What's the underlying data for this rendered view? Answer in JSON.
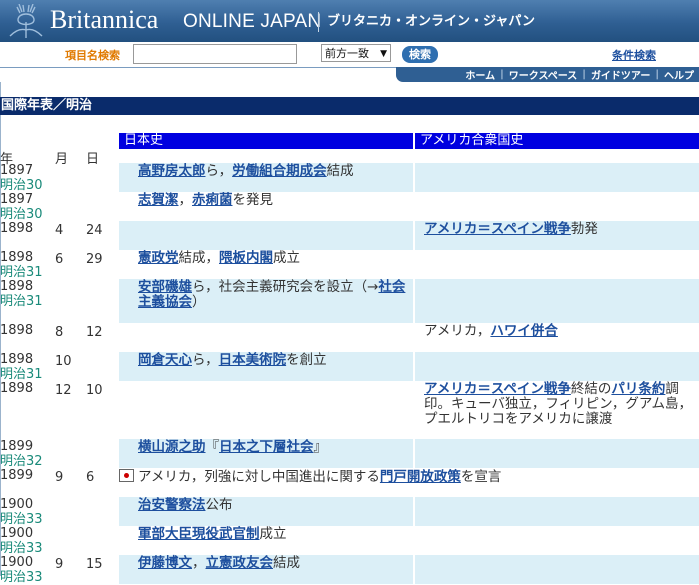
{
  "header": {
    "brand": "Britannica",
    "brand_sub": "ONLINE JAPAN",
    "brand_jp": "ブリタニカ・オンライン・ジャパン"
  },
  "search": {
    "label": "項目名検索",
    "value": "",
    "mode": "前方一致",
    "button": "検索",
    "advanced": "条件検索"
  },
  "nav": {
    "items": [
      "ホーム",
      "ワークスペース",
      "ガイドツアー",
      "ヘルプ"
    ]
  },
  "page": {
    "title": "国際年表／明治",
    "col_japan": "日本史",
    "col_us": "アメリカ合衆国史",
    "col_year": "年",
    "col_month": "月",
    "col_day": "日"
  },
  "rows": [
    {
      "year": "1897",
      "era": "明治30",
      "month": "",
      "day": "",
      "jp": [
        {
          "t": "高野房太郎",
          "link": true
        },
        {
          "t": "ら，"
        },
        {
          "t": "労働組合期成会",
          "link": true
        },
        {
          "t": "結成"
        }
      ],
      "us": []
    },
    {
      "year": "1897",
      "era": "明治30",
      "month": "",
      "day": "",
      "jp": [
        {
          "t": "志賀潔",
          "link": true
        },
        {
          "t": "，"
        },
        {
          "t": "赤痢菌",
          "link": true
        },
        {
          "t": "を発見"
        }
      ],
      "us": []
    },
    {
      "year": "1898",
      "era": "",
      "month": "4",
      "day": "24",
      "jp": [],
      "us": [
        {
          "t": "アメリカ＝スペイン戦争",
          "link": true
        },
        {
          "t": "勃発"
        }
      ]
    },
    {
      "year": "1898",
      "era": "明治31",
      "month": "6",
      "day": "29",
      "jp": [
        {
          "t": "憲政党",
          "link": true
        },
        {
          "t": "結成，"
        },
        {
          "t": "隈板内閣",
          "link": true
        },
        {
          "t": "成立"
        }
      ],
      "us": []
    },
    {
      "year": "1898",
      "era": "明治31",
      "month": "",
      "day": "",
      "jp": [
        {
          "t": "安部磯雄",
          "link": true
        },
        {
          "t": "ら，社会主義研究会を設立（→"
        },
        {
          "t": "社会主義協会",
          "link": true
        },
        {
          "t": "）"
        }
      ],
      "us": []
    },
    {
      "year": "1898",
      "era": "",
      "month": "8",
      "day": "12",
      "jp": [],
      "us": [
        {
          "t": "アメリカ，"
        },
        {
          "t": "ハワイ併合",
          "link": true
        }
      ]
    },
    {
      "year": "1898",
      "era": "明治31",
      "month": "10",
      "day": "",
      "jp": [
        {
          "t": "岡倉天心",
          "link": true
        },
        {
          "t": "ら，"
        },
        {
          "t": "日本美術院",
          "link": true
        },
        {
          "t": "を創立"
        }
      ],
      "us": []
    },
    {
      "year": "1898",
      "era": "",
      "month": "12",
      "day": "10",
      "jp": [],
      "us": [
        {
          "t": "アメリカ＝スペイン戦争",
          "link": true
        },
        {
          "t": "終結の"
        },
        {
          "t": "パリ条約",
          "link": true
        },
        {
          "t": "調印。キューバ独立，フィリピン，グアム島，プエルトリコをアメリカに譲渡"
        }
      ]
    },
    {
      "year": "1899",
      "era": "明治32",
      "month": "",
      "day": "",
      "jp": [
        {
          "t": "横山源之助",
          "link": true
        },
        {
          "t": "『"
        },
        {
          "t": "日本之下層社会",
          "link": true
        },
        {
          "t": "』"
        }
      ],
      "us": []
    },
    {
      "year": "1899",
      "era": "",
      "month": "9",
      "day": "6",
      "jp": [
        {
          "t": "アメリカ，列強に対し中国進出に関する"
        },
        {
          "t": "門戸開放政策",
          "link": true
        },
        {
          "t": "を宣言"
        }
      ],
      "us": [],
      "shared": true
    },
    {
      "year": "1900",
      "era": "明治33",
      "month": "",
      "day": "",
      "jp": [
        {
          "t": "治安警察法",
          "link": true
        },
        {
          "t": "公布"
        }
      ],
      "us": []
    },
    {
      "year": "1900",
      "era": "明治33",
      "month": "",
      "day": "",
      "jp": [
        {
          "t": "軍部大臣現役武官制",
          "link": true
        },
        {
          "t": "成立"
        }
      ],
      "us": []
    },
    {
      "year": "1900",
      "era": "明治33",
      "month": "9",
      "day": "15",
      "jp": [
        {
          "t": "伊藤博文",
          "link": true
        },
        {
          "t": "，"
        },
        {
          "t": "立憲政友会",
          "link": true
        },
        {
          "t": "結成"
        }
      ],
      "us": []
    }
  ]
}
